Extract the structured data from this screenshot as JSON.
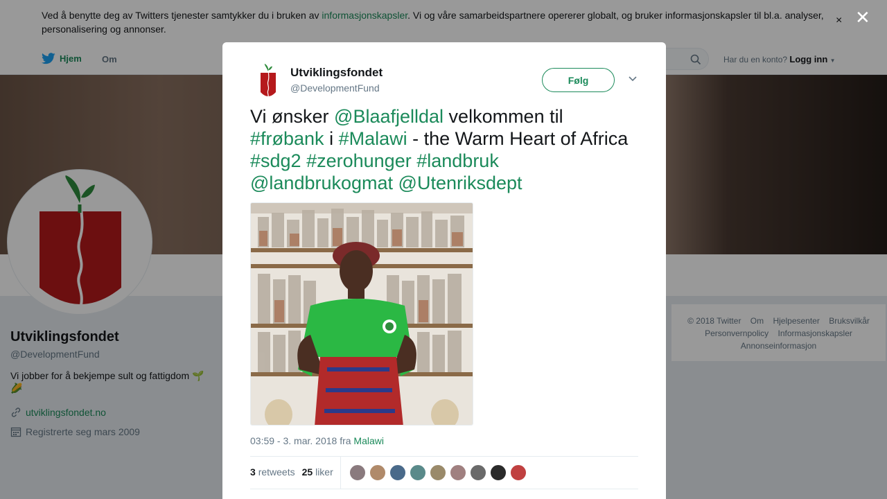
{
  "cookie": {
    "text_before": "Ved å benytte deg av Twitters tjenester samtykker du i bruken av ",
    "link": "informasjonskapsler",
    "text_after": ". Vi og våre samarbeidspartnere opererer globalt, og bruker informasjonskapsler til bl.a. analyser, personalisering og annonser.",
    "close": "×"
  },
  "nav": {
    "home": "Hjem",
    "about": "Om",
    "login_prompt": "Har du en konto?",
    "login": "Logg inn"
  },
  "profile": {
    "name": "Utviklingsfondet",
    "handle": "@DevelopmentFund",
    "bio": "Vi jobber for å bekjempe sult og fattigdom 🌱🌽",
    "link": "utviklingsfondet.no",
    "joined": "Registrerte seg mars 2009"
  },
  "footer": {
    "items": [
      "© 2018 Twitter",
      "Om",
      "Hjelpesenter",
      "Bruksvilkår",
      "Personvernpolicy",
      "Informasjonskapsler",
      "Annonseinformasjon"
    ]
  },
  "overlay": {
    "close": "✕"
  },
  "tweet": {
    "author_name": "Utviklingsfondet",
    "author_handle": "@DevelopmentFund",
    "follow": "Følg",
    "text_parts": [
      {
        "t": "Vi ønsker ",
        "hl": false
      },
      {
        "t": "@Blaafjelldal",
        "hl": true
      },
      {
        "t": " velkommen til ",
        "hl": false
      },
      {
        "t": "#frøbank",
        "hl": true
      },
      {
        "t": " i ",
        "hl": false
      },
      {
        "t": "#Malawi",
        "hl": true
      },
      {
        "t": " - the Warm Heart of Africa ",
        "hl": false
      },
      {
        "t": "#sdg2",
        "hl": true
      },
      {
        "t": " ",
        "hl": false
      },
      {
        "t": "#zerohunger",
        "hl": true
      },
      {
        "t": " ",
        "hl": false
      },
      {
        "t": "#landbruk",
        "hl": true
      },
      {
        "t": " ",
        "hl": false
      },
      {
        "t": "@landbrukogmat",
        "hl": true
      },
      {
        "t": " ",
        "hl": false
      },
      {
        "t": "@Utenriksdept",
        "hl": true
      }
    ],
    "time": "03:59 - 3. mar. 2018 fra ",
    "location": "Malawi",
    "retweets_count": "3",
    "retweets_label": "retweets",
    "likes_count": "25",
    "likes_label": "liker",
    "liker_colors": [
      "#8a7a7e",
      "#b08a6a",
      "#4a6a8a",
      "#5a8a8a",
      "#9a8a6a",
      "#a08080",
      "#6a6a6a",
      "#2a2a2a",
      "#c04040"
    ]
  },
  "colors": {
    "accent": "#1b8a5a",
    "logo_red": "#b5191c",
    "logo_green": "#2e8b3c"
  }
}
